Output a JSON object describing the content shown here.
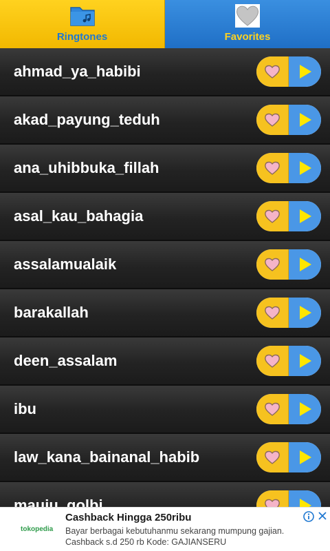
{
  "tabs": {
    "ringtones_label": "Ringtones",
    "favorites_label": "Favorites",
    "ringtones_icon": "folder-music-icon",
    "favorites_icon": "heart-icon"
  },
  "ringtones": [
    "ahmad_ya_habibi",
    "akad_payung_teduh",
    "ana_uhibbuka_fillah",
    "asal_kau_bahagia",
    "assalamualaik",
    "barakallah",
    "deen_assalam",
    "ibu",
    "law_kana_bainanal_habib",
    "mauju_qolbi"
  ],
  "row_icons": {
    "favorite": "heart-icon",
    "play": "play-icon"
  },
  "ad": {
    "logo": "tokopedia",
    "headline": "Cashback Hingga 250ribu",
    "body": "Bayar berbagai kebutuhanmu sekarang mumpung gajian. Cashback s.d 250 rb Kode: GAJIANSERU",
    "info_icon": "info-icon",
    "close_icon": "close-icon"
  },
  "colors": {
    "tab_active": "#f6c21f",
    "tab_inactive": "#2a7fd6",
    "row_bg": "#262626",
    "heart_fill": "#f5b4c8",
    "play_fill": "#ffe600"
  }
}
